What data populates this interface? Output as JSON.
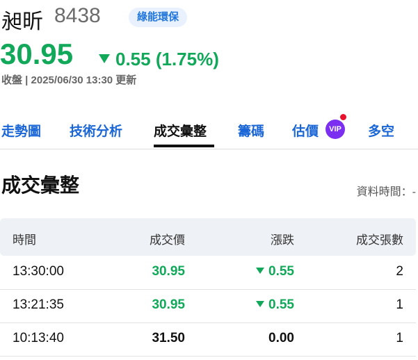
{
  "stock": {
    "name": "昶昕",
    "code": "8438",
    "tag": "綠能環保",
    "price": "30.95",
    "change": "0.55 (1.75%)",
    "update": "收盤 | 2025/06/30 13:30 更新"
  },
  "tabs": [
    "走勢圖",
    "技術分析",
    "成交彙整",
    "籌碼",
    "估價",
    "多空"
  ],
  "vip_label": "VIP",
  "section": {
    "title": "成交彙整",
    "data_time": "資料時間：-"
  },
  "table": {
    "headers": [
      "時間",
      "成交價",
      "漲跌",
      "成交張數"
    ],
    "rows": [
      {
        "time": "13:30:00",
        "price": "30.95",
        "change": "0.55",
        "volume": "2",
        "dir": "down"
      },
      {
        "time": "13:21:35",
        "price": "30.95",
        "change": "0.55",
        "volume": "1",
        "dir": "down"
      },
      {
        "time": "10:13:40",
        "price": "31.50",
        "change": "0.00",
        "volume": "1",
        "dir": "flat"
      }
    ]
  },
  "colors": {
    "down": "#11a85a",
    "link": "#1a66d6",
    "vip": "#7b2ff0"
  }
}
